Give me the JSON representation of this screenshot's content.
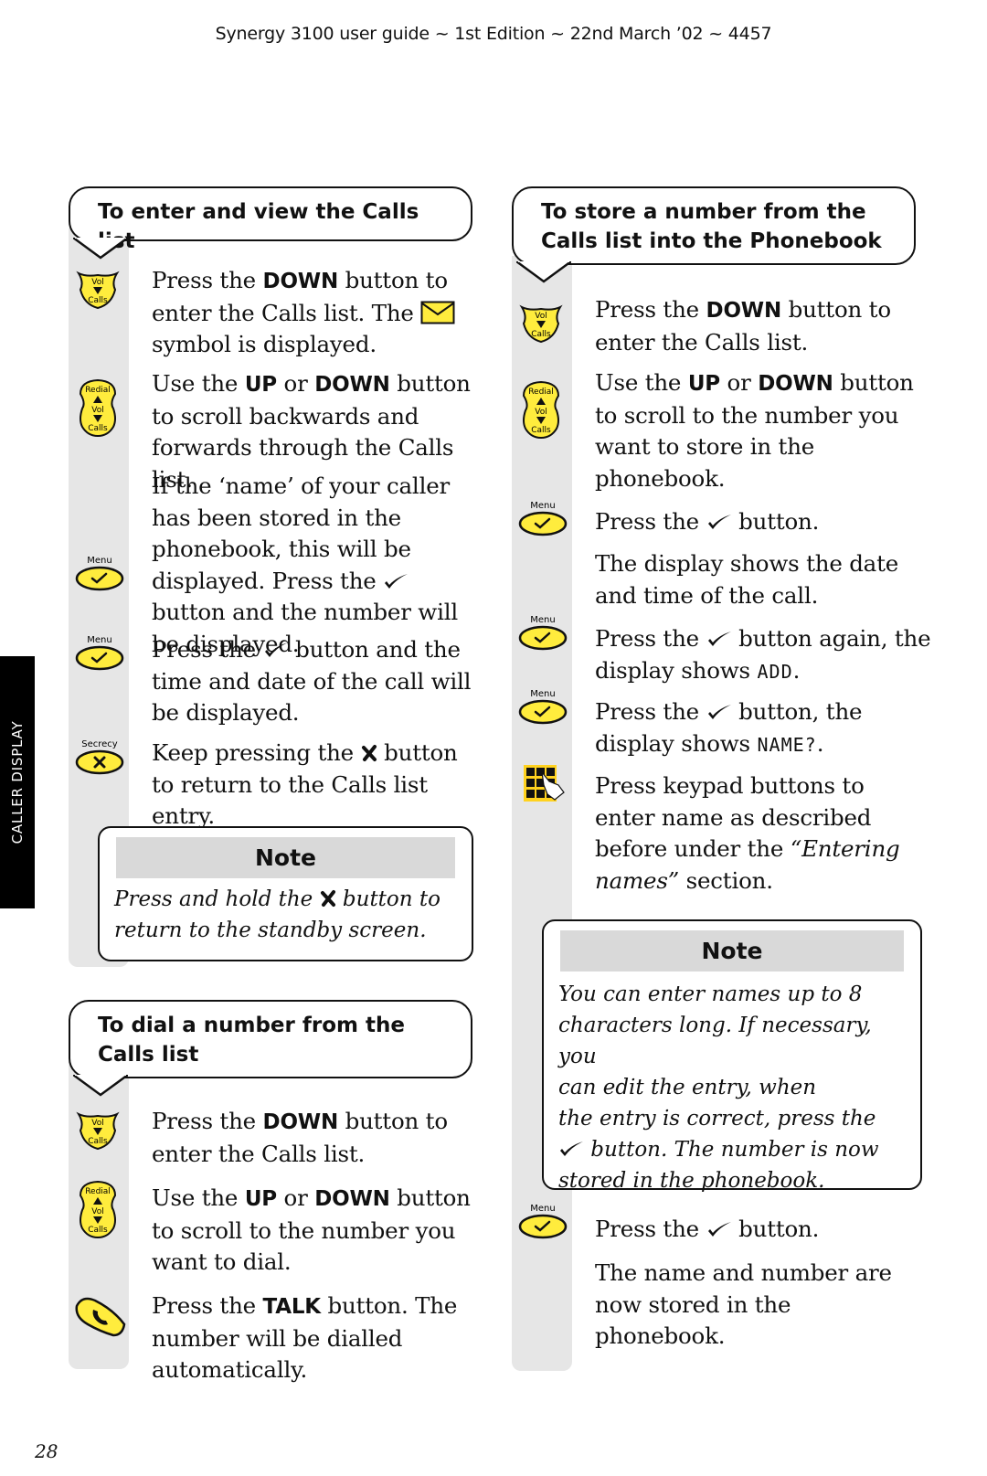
{
  "running_head": "Synergy 3100 user guide ~ 1st Edition ~ 22nd March ’02 ~ 4457",
  "side_tab": "CALLER DISPLAY",
  "page_number": "28",
  "colors": {
    "button_yellow": "#ffec3d",
    "strip_gray": "#e6e6e6",
    "note_head_gray": "#d9d9d9",
    "side_tab_black": "#000000"
  },
  "button_labels": {
    "vol": "Vol",
    "calls": "Calls",
    "redial": "Redial",
    "menu": "Menu",
    "secrecy": "Secrecy"
  },
  "section_view": {
    "title": "To enter and view the Calls list",
    "steps": [
      {
        "icon": "vol-down-button-icon",
        "pre": "Press the ",
        "bold": "DOWN",
        "post": " button to enter the Calls list. The ",
        "post2": " symbol is displayed."
      },
      {
        "icon": "up-down-button-icon",
        "pre": "Use the ",
        "bold": "UP",
        "mid": " or ",
        "bold2": "DOWN",
        "post": " button to scroll backwards and forwards through the Calls list."
      },
      {
        "icon": "menu-check-button-icon",
        "pre": "If the ‘name’ of your caller has been stored in the phonebook, this will be displayed. Press the ",
        "post": " button and the number will be displayed."
      },
      {
        "icon": "menu-check-button-icon",
        "pre": "Press the ",
        "post": " button and the time and date of the call will be displayed."
      },
      {
        "icon": "secrecy-x-button-icon",
        "pre": "Keep pressing the ",
        "post": " button to return to the Calls list entry."
      }
    ],
    "note": {
      "heading": "Note",
      "pre": "Press and hold the ",
      "post": " button to return to the standby screen."
    }
  },
  "section_dial": {
    "title_line1": "To dial a number from the",
    "title_line2": "Calls list",
    "steps": [
      {
        "icon": "vol-down-button-icon",
        "pre": "Press the ",
        "bold": "DOWN",
        "post": " button to enter the Calls list."
      },
      {
        "icon": "up-down-button-icon",
        "pre": "Use the ",
        "bold": "UP",
        "mid": " or ",
        "bold2": "DOWN",
        "post": " button to scroll to the number you want to dial."
      },
      {
        "icon": "talk-button-icon",
        "pre": "Press the ",
        "bold": "TALK",
        "post": " button. The number will be dialled automatically."
      }
    ]
  },
  "section_store": {
    "title_line1": "To store a number from the",
    "title_line2": "Calls list into the Phonebook",
    "steps": [
      {
        "icon": "vol-down-button-icon",
        "pre": "Press the ",
        "bold": "DOWN",
        "post": " button to enter the Calls list."
      },
      {
        "icon": "up-down-button-icon",
        "pre": "Use the ",
        "bold": "UP",
        "mid": " or ",
        "bold2": "DOWN",
        "post": " button to scroll to the number you want to store in the phonebook."
      },
      {
        "icon": "menu-check-button-icon",
        "pre": "Press the ",
        "post": " button."
      },
      {
        "icon": "",
        "text": "The display shows the date and time of the call."
      },
      {
        "icon": "menu-check-button-icon",
        "pre": "Press the ",
        "post": " button again, the display shows ",
        "lcd": "ADD",
        "post2": "."
      },
      {
        "icon": "menu-check-button-icon",
        "pre": "Press the ",
        "post": " button, the display shows ",
        "lcd": "NAME?",
        "post2": "."
      },
      {
        "icon": "keypad-icon",
        "pre": "Press keypad buttons to enter name as described before under the ",
        "italic": "“Entering names”",
        "post": " section."
      },
      {
        "icon": "menu-check-button-icon",
        "pre": "Press the ",
        "post": " button."
      },
      {
        "icon": "",
        "text": "The name and number are now stored in the phonebook."
      }
    ],
    "note": {
      "heading": "Note",
      "line1": "You can enter names up to 8",
      "line2": "characters long. If necessary, you",
      "line3": "can edit the entry, when",
      "line4": "the entry is correct, press the",
      "line5": " button. The number is now",
      "line6": "stored in the phonebook."
    }
  }
}
